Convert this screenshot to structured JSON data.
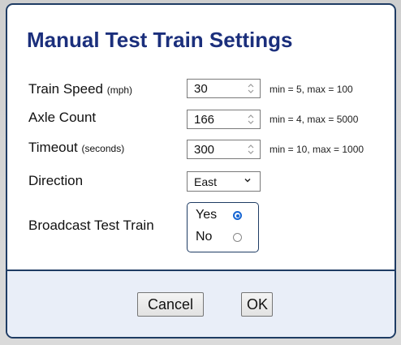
{
  "dialog": {
    "title": "Manual Test Train Settings"
  },
  "fields": {
    "train_speed": {
      "label": "Train Speed",
      "unit": "(mph)",
      "value": "30",
      "hint": "min = 5, max = 100"
    },
    "axle_count": {
      "label": "Axle Count",
      "value": "166",
      "hint": "min = 4, max = 5000"
    },
    "timeout": {
      "label": "Timeout",
      "unit": "(seconds)",
      "value": "300",
      "hint": "min = 10, max = 1000"
    },
    "direction": {
      "label": "Direction",
      "selected": "East",
      "icon": "chevron-down-icon"
    },
    "broadcast": {
      "label": "Broadcast Test Train",
      "yes_label": "Yes",
      "no_label": "No",
      "selected": "Yes"
    }
  },
  "buttons": {
    "cancel_label": "Cancel",
    "ok_label": "OK"
  },
  "colors": {
    "title": "#1b2f7c",
    "border": "#1f3c64",
    "footer_bg": "#e9eef8",
    "radio_accent": "#1766d3"
  }
}
